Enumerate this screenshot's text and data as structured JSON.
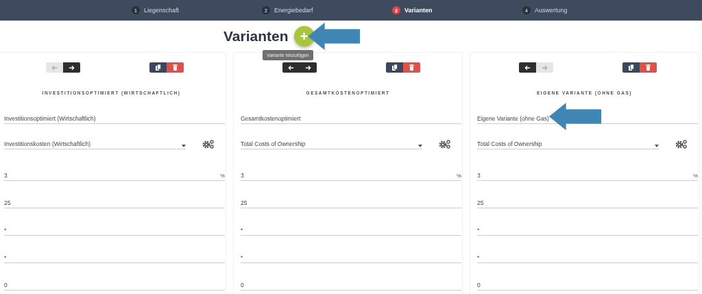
{
  "steps": [
    {
      "number": "1",
      "label": "Liegenschaft",
      "selected": false
    },
    {
      "number": "2",
      "label": "Energiebedarf",
      "selected": false
    },
    {
      "number": "3",
      "label": "Varianten",
      "selected": true
    },
    {
      "number": "4",
      "label": "Auswertung",
      "selected": false
    }
  ],
  "title": "Varianten",
  "add_button": {
    "icon": "+",
    "tooltip": "Variante hinzufügen"
  },
  "variants": [
    {
      "prev_disabled": true,
      "next_disabled": false,
      "heading": "INVESTITIONSOPTIMIERT (WIRTSCHAFTLICH)",
      "name": "Investitionsoptimiert (Wirtschaftlich)",
      "objective": "Investitionskosten (Wirtschaftlich)",
      "fields": [
        {
          "value": "3",
          "unit": "%"
        },
        {
          "value": "25"
        },
        {
          "value": "*"
        },
        {
          "value": "*"
        },
        {
          "value": "0"
        }
      ],
      "annotated": false
    },
    {
      "prev_disabled": false,
      "next_disabled": false,
      "heading": "GESAMTKOSTENOPTIMIERT",
      "name": "Gesamtkostenoptimiert",
      "objective": "Total Costs of Ownership",
      "fields": [
        {
          "value": "3",
          "unit": "%"
        },
        {
          "value": "25"
        },
        {
          "value": "*"
        },
        {
          "value": "*"
        },
        {
          "value": "0"
        }
      ],
      "annotated": false
    },
    {
      "prev_disabled": false,
      "next_disabled": true,
      "heading": "EIGENE VARIANTE (OHNE GAS)",
      "name": "Eigene Variante (ohne Gas)",
      "objective": "Total Costs of Ownership",
      "fields": [
        {
          "value": "3",
          "unit": "%"
        },
        {
          "value": "25"
        },
        {
          "value": "*"
        },
        {
          "value": "*"
        },
        {
          "value": "0"
        }
      ],
      "annotated": true
    }
  ]
}
